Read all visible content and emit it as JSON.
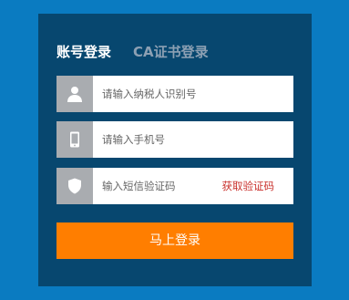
{
  "tabs": {
    "account_login": "账号登录",
    "ca_login": "CA证书登录"
  },
  "fields": {
    "taxpayer_id": {
      "icon": "user-icon",
      "placeholder": "请输入纳税人识别号",
      "value": ""
    },
    "phone": {
      "icon": "mobile-phone-icon",
      "placeholder": "请输入手机号",
      "value": ""
    },
    "sms_code": {
      "icon": "shield-icon",
      "placeholder": "输入短信验证码",
      "value": "",
      "get_code_label": "获取验证码"
    }
  },
  "submit_label": "马上登录",
  "colors": {
    "page_background": "#0a7bc1",
    "panel_background": "#07476f",
    "icon_box": "#a9acb0",
    "submit_button": "#ff7e00",
    "get_code_link": "#c9302c",
    "inactive_tab": "#8ca0b3"
  }
}
